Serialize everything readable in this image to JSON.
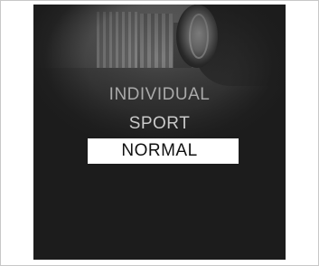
{
  "drive_mode_menu": {
    "items": [
      {
        "label": "INDIVIDUAL",
        "selected": false
      },
      {
        "label": "SPORT",
        "selected": false
      },
      {
        "label": "NORMAL",
        "selected": true
      }
    ],
    "colors": {
      "screen_background": "#1c1c1c",
      "item_text": "#c4c4c4",
      "selected_background": "#ffffff",
      "selected_text": "#111111"
    }
  }
}
